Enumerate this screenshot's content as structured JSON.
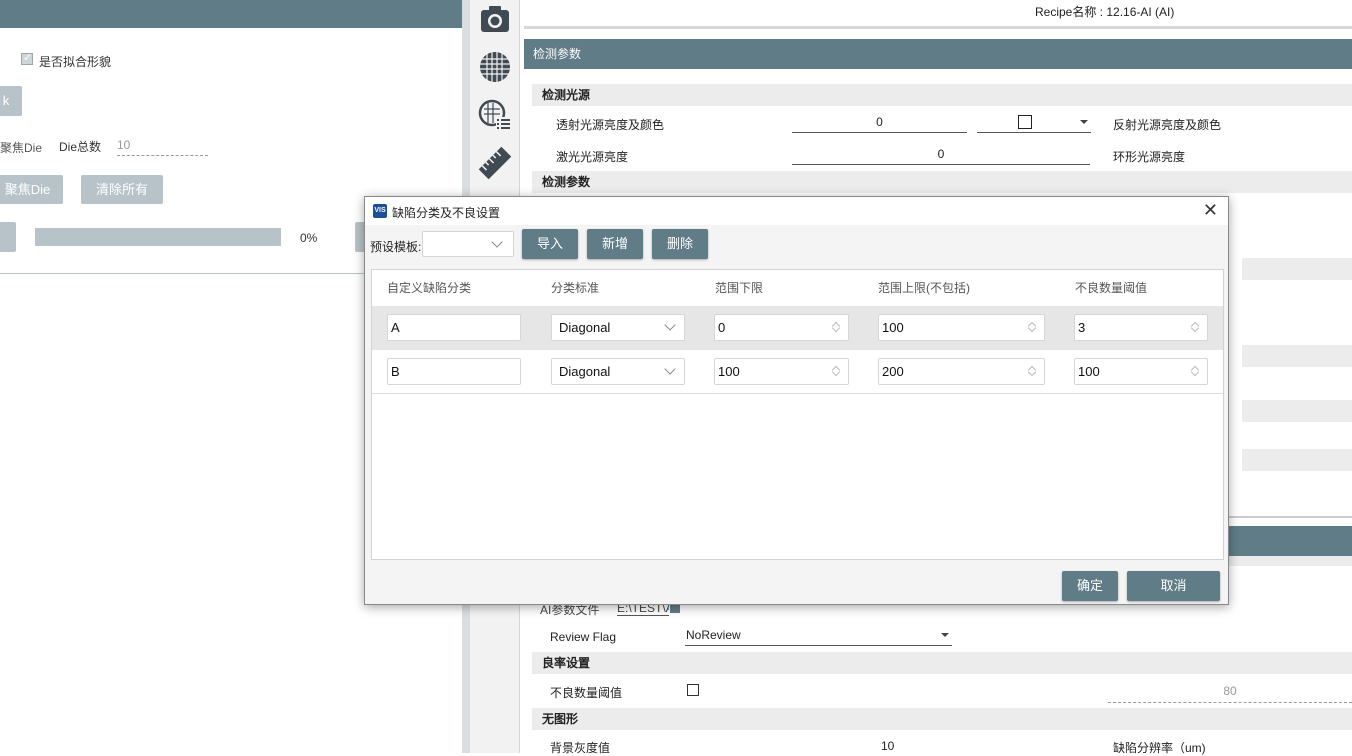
{
  "left": {
    "fit_shape_label": "是否拟合形貌",
    "btn_k": "k",
    "focus_die_label": "聚焦Die",
    "die_total_label": "Die总数",
    "die_total_value": "10",
    "btn_focus_die": "聚焦Die",
    "btn_clear_all": "清除所有",
    "progress_text": "0%",
    "progress_value": 0
  },
  "toolbar": {
    "icons": [
      "camera-icon",
      "grid-circle-icon",
      "wafer-list-icon",
      "ruler-icon"
    ]
  },
  "right": {
    "recipe_name": "Recipe名称 : 12.16-AI (AI)",
    "section_detect_params": "检测参数",
    "sub_light_source": "检测光源",
    "transmit_light_label": "透射光源亮度及颜色",
    "transmit_light_value": "0",
    "reflect_light_label": "反射光源亮度及颜色",
    "laser_light_label": "激光光源亮度",
    "laser_light_value": "0",
    "ring_light_label": "环形光源亮度",
    "sub_detect_params": "检测参数",
    "ai_param_file_label": "AI参数文件",
    "ai_param_file_value": "E:\\TEST\\AI",
    "review_flag_label": "Review Flag",
    "review_flag_value": "NoReview",
    "sub_yield": "良率设置",
    "defect_threshold_label": "不良数量阈值",
    "defect_threshold_value": "80",
    "sub_no_pattern": "无图形",
    "bg_gray_label": "背景灰度值",
    "bg_gray_value": "10",
    "defect_res_label": "缺陷分辨率（um)"
  },
  "dialog": {
    "title": "缺陷分类及不良设置",
    "preset_label": "预设模板:",
    "preset_value": "",
    "btn_import": "导入",
    "btn_add": "新增",
    "btn_delete": "删除",
    "columns": [
      "自定义缺陷分类",
      "分类标准",
      "范围下限",
      "范围上限(不包括)",
      "不良数量阈值"
    ],
    "rows": [
      {
        "name": "A",
        "standard": "Diagonal",
        "low": "0",
        "high": "100",
        "threshold": "3"
      },
      {
        "name": "B",
        "standard": "Diagonal",
        "low": "100",
        "high": "200",
        "threshold": "100"
      }
    ],
    "btn_ok": "确定",
    "btn_cancel": "取消"
  },
  "colors": {
    "header": "#5f7c87",
    "gray_button": "#b7c3c8",
    "row_stripe": "#e6e6e6"
  }
}
